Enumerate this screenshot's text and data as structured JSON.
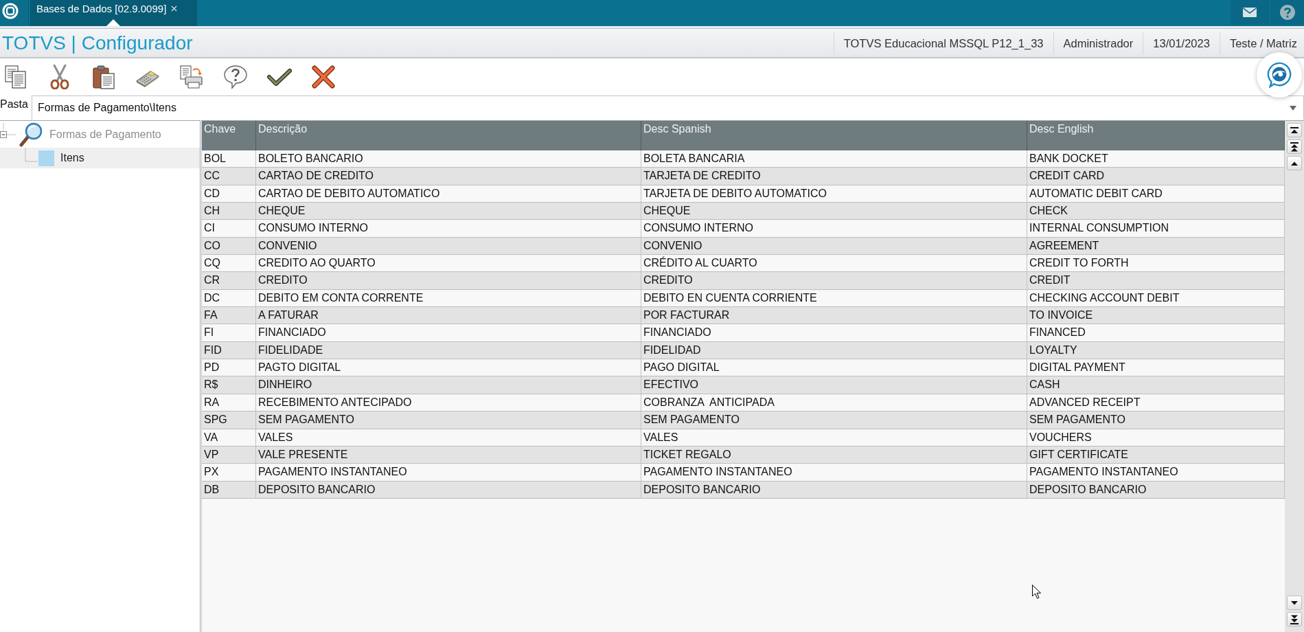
{
  "top_bar": {
    "tabs": [
      {
        "label": "Bases de Dados [02.9.0099]",
        "selected": true
      }
    ]
  },
  "header": {
    "title": "TOTVS | Configurador",
    "info": [
      "TOTVS Educacional MSSQL P12_1_33",
      "Administrador",
      "13/01/2023",
      "Teste / Matriz"
    ]
  },
  "folder_path": {
    "label": "Pasta",
    "value": "Formas de Pagamento\\Itens"
  },
  "tree": [
    {
      "label": "Formas de Pagamento",
      "expanded": true,
      "selected": false,
      "children": [
        {
          "label": "Itens",
          "selected": true
        }
      ]
    }
  ],
  "table": {
    "columns": [
      "Chave",
      "Descrição",
      "Desc Spanish",
      "Desc English"
    ],
    "rows": [
      [
        "BOL",
        "BOLETO BANCARIO",
        "BOLETA BANCARIA",
        "BANK DOCKET"
      ],
      [
        "CC",
        "CARTAO DE CREDITO",
        "TARJETA DE CREDITO",
        "CREDIT CARD"
      ],
      [
        "CD",
        "CARTAO DE DEBITO AUTOMATICO",
        "TARJETA DE DEBITO AUTOMATICO",
        "AUTOMATIC DEBIT CARD"
      ],
      [
        "CH",
        "CHEQUE",
        "CHEQUE",
        "CHECK"
      ],
      [
        "CI",
        "CONSUMO INTERNO",
        "CONSUMO INTERNO",
        "INTERNAL CONSUMPTION"
      ],
      [
        "CO",
        "CONVENIO",
        "CONVENIO",
        "AGREEMENT"
      ],
      [
        "CQ",
        "CREDITO AO QUARTO",
        "CRÉDITO AL CUARTO",
        "CREDIT TO FORTH"
      ],
      [
        "CR",
        "CREDITO",
        "CREDITO",
        "CREDIT"
      ],
      [
        "DC",
        "DEBITO EM CONTA CORRENTE",
        "DEBITO EN CUENTA CORRIENTE",
        "CHECKING ACCOUNT DEBIT"
      ],
      [
        "FA",
        "A FATURAR",
        "POR FACTURAR",
        "TO INVOICE"
      ],
      [
        "FI",
        "FINANCIADO",
        "FINANCIADO",
        "FINANCED"
      ],
      [
        "FID",
        "FIDELIDADE",
        "FIDELIDAD",
        "LOYALTY"
      ],
      [
        "PD",
        "PAGTO DIGITAL",
        "PAGO DIGITAL",
        "DIGITAL PAYMENT"
      ],
      [
        "R$",
        "DINHEIRO",
        "EFECTIVO",
        "CASH"
      ],
      [
        "RA",
        "RECEBIMENTO ANTECIPADO",
        "COBRANZA  ANTICIPADA",
        "ADVANCED RECEIPT"
      ],
      [
        "SPG",
        "SEM PAGAMENTO",
        "SEM PAGAMENTO",
        "SEM PAGAMENTO"
      ],
      [
        "VA",
        "VALES",
        "VALES",
        "VOUCHERS"
      ],
      [
        "VP",
        "VALE PRESENTE",
        "TICKET REGALO",
        "GIFT CERTIFICATE"
      ],
      [
        "PX",
        "PAGAMENTO INSTANTANEO",
        "PAGAMENTO INSTANTANEO",
        "PAGAMENTO INSTANTANEO"
      ],
      [
        "DB",
        "DEPOSITO BANCARIO",
        "DEPOSITO BANCARIO",
        "DEPOSITO BANCARIO"
      ]
    ]
  }
}
